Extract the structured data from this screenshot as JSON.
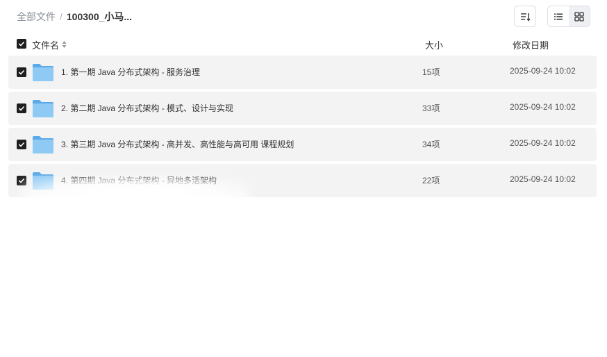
{
  "breadcrumb": {
    "root": "全部文件",
    "separator": "/",
    "current": "100300_小马..."
  },
  "toolbar": {
    "sort_icon": "sort-icon",
    "list_view_icon": "list-view-icon",
    "grid_view_icon": "grid-view-icon"
  },
  "columns": {
    "name": "文件名",
    "size": "大小",
    "date": "修改日期"
  },
  "rows": [
    {
      "name": "1. 第一期 Java 分布式架构 - 服务治理",
      "size": "15项",
      "date": "2025-09-24 10:02"
    },
    {
      "name": "2. 第二期 Java 分布式架构 - 模式、设计与实现",
      "size": "33项",
      "date": "2025-09-24 10:02"
    },
    {
      "name": "3. 第三期 Java 分布式架构 - 高并发、高性能与高可用 课程规划",
      "size": "34项",
      "date": "2025-09-24 10:02"
    },
    {
      "name": "4. 第四期 Java 分布式架构 - 异地多活架构",
      "size": "22项",
      "date": "2025-09-24 10:02"
    }
  ],
  "colors": {
    "row_bg": "#f3f3f4",
    "checkbox": "#1f1f1f",
    "folder": "#7cc0f2"
  }
}
